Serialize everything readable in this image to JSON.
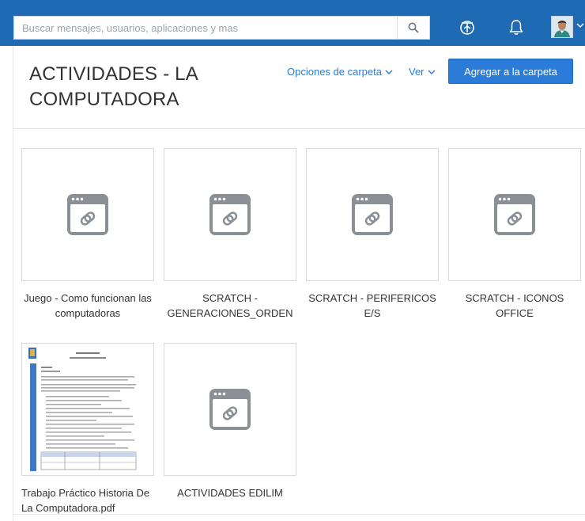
{
  "search": {
    "placeholder": "Buscar mensajes, usuarios, aplicaciones y mas"
  },
  "colors": {
    "topbar": "#1e6ab3",
    "accent": "#2b7bd9",
    "thumb_border": "#d6dbe0",
    "icon_gray": "#8a9096"
  },
  "topbar_icons": [
    "search-icon",
    "tokens-icon",
    "bell-icon",
    "avatar",
    "chevron-down-icon"
  ],
  "header": {
    "title": "ACTIVIDADES - LA COMPUTADORA",
    "folder_options": "Opciones de carpeta",
    "view": "Ver",
    "add_button": "Agregar a la carpeta"
  },
  "items": [
    {
      "caption": "Juego - Como funcionan las computadoras",
      "kind": "link",
      "icon": "link-icon"
    },
    {
      "caption": "SCRATCH - GENERACIONES_ORDEN",
      "kind": "link",
      "icon": "link-icon"
    },
    {
      "caption": "SCRATCH - PERIFERICOS E/S",
      "kind": "link",
      "icon": "link-icon"
    },
    {
      "caption": "SCRATCH - ICONOS OFFICE",
      "kind": "link",
      "icon": "link-icon"
    },
    {
      "caption": "Trabajo Práctico Historia De La Computadora.pdf",
      "kind": "pdf",
      "icon": "document-thumbnail"
    },
    {
      "caption": "ACTIVIDADES EDILIM",
      "kind": "link",
      "icon": "link-icon"
    }
  ]
}
